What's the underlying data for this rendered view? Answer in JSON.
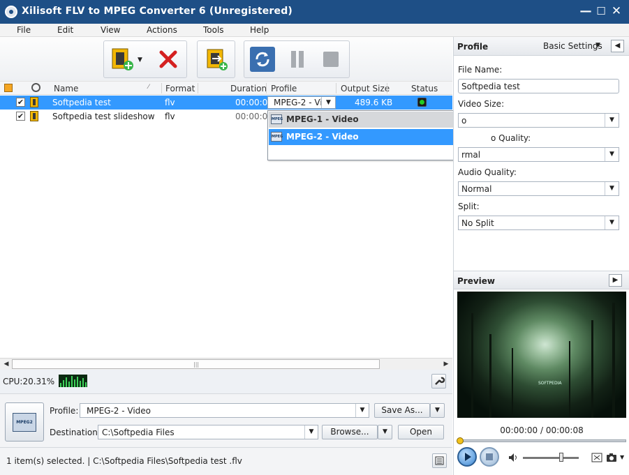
{
  "window": {
    "title": "Xilisoft FLV to MPEG Converter 6 (Unregistered)",
    "minimize": "—",
    "maximize": "☐",
    "close": "✕"
  },
  "menu": [
    "File",
    "Edit",
    "View",
    "Actions",
    "Tools",
    "Help"
  ],
  "toolbar": {
    "icons": [
      "add-file-icon",
      "remove-icon",
      "add-segment-icon",
      "convert-icon",
      "pause-icon",
      "stop-icon"
    ]
  },
  "table": {
    "columns": [
      "Name",
      "Format",
      "Duration",
      "Profile",
      "Output Size",
      "Status"
    ],
    "rows": [
      {
        "checked": true,
        "name": "Softpedia test",
        "format": "flv",
        "duration": "00:00:08",
        "profile": "MPEG-2 - Vi",
        "output_size": "489.6 KB",
        "status": "ready"
      },
      {
        "checked": true,
        "name": "Softpedia test slideshow",
        "format": "flv",
        "duration": "00:00:08",
        "profile": "",
        "output_size": "",
        "status": ""
      }
    ]
  },
  "profile_dropdown": {
    "options": [
      "MPEG-1 - Video",
      "MPEG-2 - Video"
    ],
    "selected": "MPEG-2 - Video",
    "icon_text": "MPEG"
  },
  "cpu": {
    "label": "CPU:20.31%"
  },
  "bottom": {
    "profile_label": "Profile:",
    "profile_value": "MPEG-2 - Video",
    "save_as": "Save As...",
    "destination_label": "Destination:",
    "destination_value": "C:\\Softpedia Files",
    "browse": "Browse...",
    "open": "Open",
    "format_icon_text": "MPEG2"
  },
  "status": {
    "text": "1 item(s) selected. | C:\\Softpedia Files\\Softpedia test .flv"
  },
  "right_panel": {
    "profile_title": "Profile",
    "basic_settings": "Basic Settings",
    "file_name_label": "File Name:",
    "file_name_value": "Softpedia test",
    "video_size_label": "Video Size:",
    "video_size_value": "o",
    "video_quality_label": "o Quality:",
    "video_quality_value": "rmal",
    "audio_quality_label": "Audio Quality:",
    "audio_quality_value": "Normal",
    "split_label": "Split:",
    "split_value": "No Split",
    "preview_title": "Preview",
    "time": "00:00:00 / 00:00:08",
    "preview_caption": "SOFTPEDIA"
  },
  "colors": {
    "titlebar": "#1e4f86",
    "selection": "#3399ff",
    "status_ok": "#22cc22"
  }
}
